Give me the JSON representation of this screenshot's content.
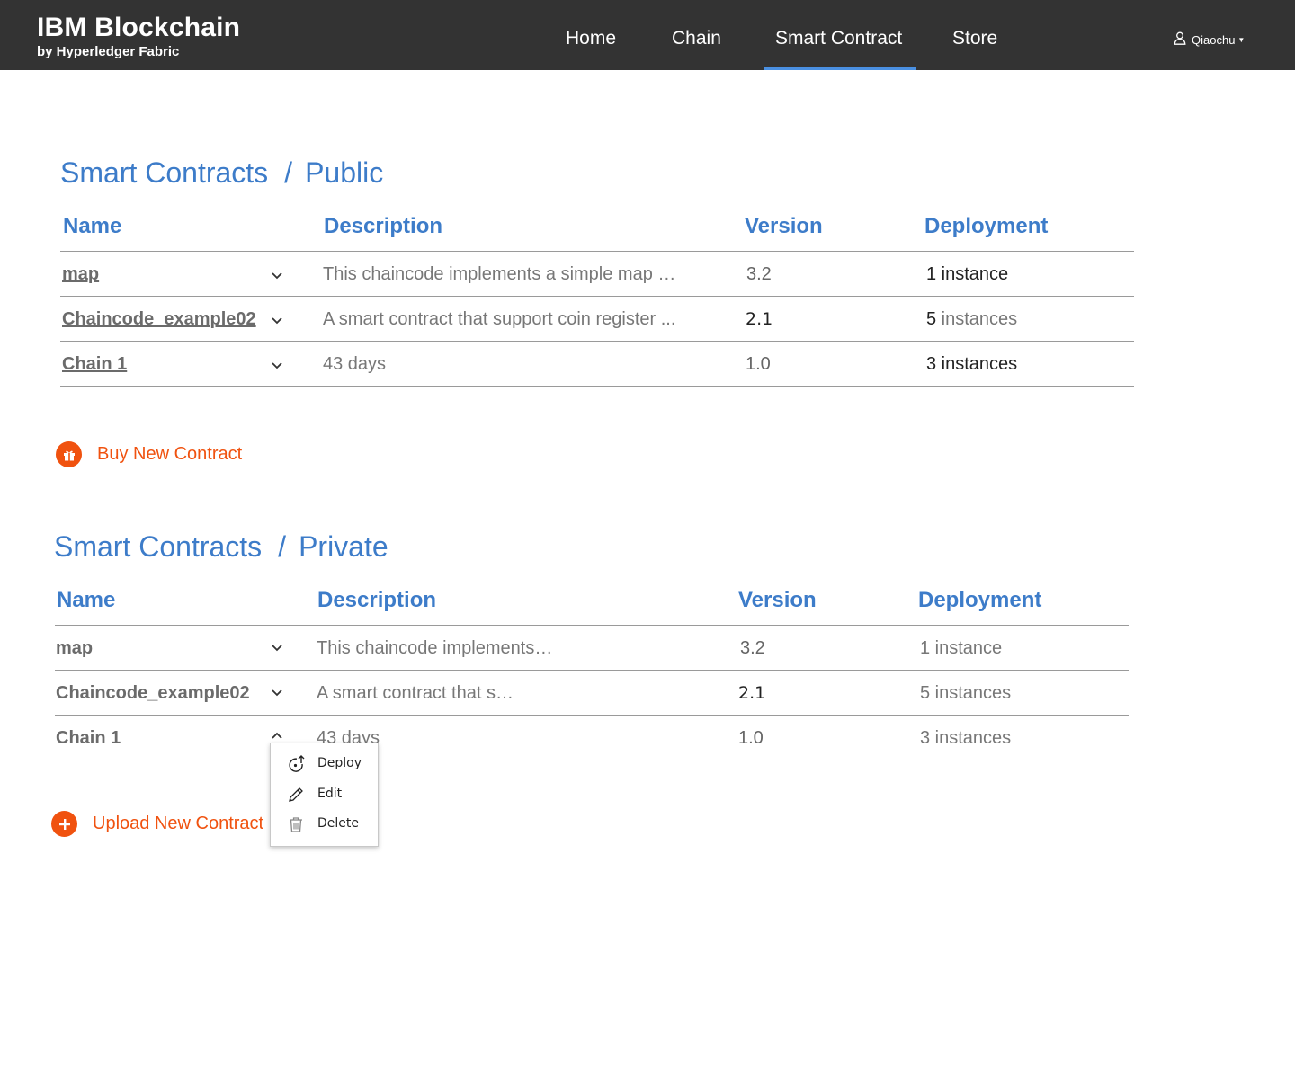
{
  "header": {
    "brand_title": "IBM Blockchain",
    "brand_subtitle": "by Hyperledger Fabric",
    "nav": [
      "Home",
      "Chain",
      "Smart Contract",
      "Store"
    ],
    "active_nav": "Smart Contract",
    "user_name": "Qiaochu",
    "user_icon": "user-icon",
    "accent_color": "#4a90e2",
    "bg_color": "#333333"
  },
  "public_section": {
    "title_main": "Smart Contracts",
    "title_sep": "/",
    "title_sub": "Public",
    "columns": [
      "Name",
      "Description",
      "Version",
      "Deployment"
    ],
    "rows": [
      {
        "name": "map",
        "description": "This chaincode implements  a simple map …",
        "version": "3.2",
        "dep_count": "1",
        "dep_unit": " instance"
      },
      {
        "name": "Chaincode_example02",
        "description": "A smart contract that support coin register ...",
        "version": "2.1",
        "dep_count": "5",
        "dep_unit": " instances"
      },
      {
        "name": "Chain 1",
        "description": "43 days",
        "version": "1.0",
        "dep_count": "3",
        "dep_unit": " instances"
      }
    ],
    "action_label": "Buy New Contract",
    "action_icon": "gift-icon"
  },
  "private_section": {
    "title_main": "Smart Contracts",
    "title_sep": "/",
    "title_sub": "Private",
    "columns": [
      "Name",
      "Description",
      "Version",
      "Deployment"
    ],
    "rows": [
      {
        "name": "map",
        "description": "This chaincode implements…",
        "version": "3.2",
        "deployment": "1 instance"
      },
      {
        "name": "Chaincode_example02",
        "description": "A smart contract that s…",
        "version": "2.1",
        "deployment": "5 instances"
      },
      {
        "name": "Chain 1",
        "description": "43 days",
        "version": "1.0",
        "deployment": "3 instances"
      }
    ],
    "action_label": "Upload New Contract",
    "action_icon": "plus-icon"
  },
  "context_menu": {
    "items": [
      {
        "label": "Deploy",
        "icon": "deploy-icon"
      },
      {
        "label": "Edit",
        "icon": "pencil-icon"
      },
      {
        "label": "Delete",
        "icon": "trash-icon"
      }
    ]
  },
  "colors": {
    "heading_blue": "#3d7cc9",
    "action_orange": "#f0520f"
  }
}
